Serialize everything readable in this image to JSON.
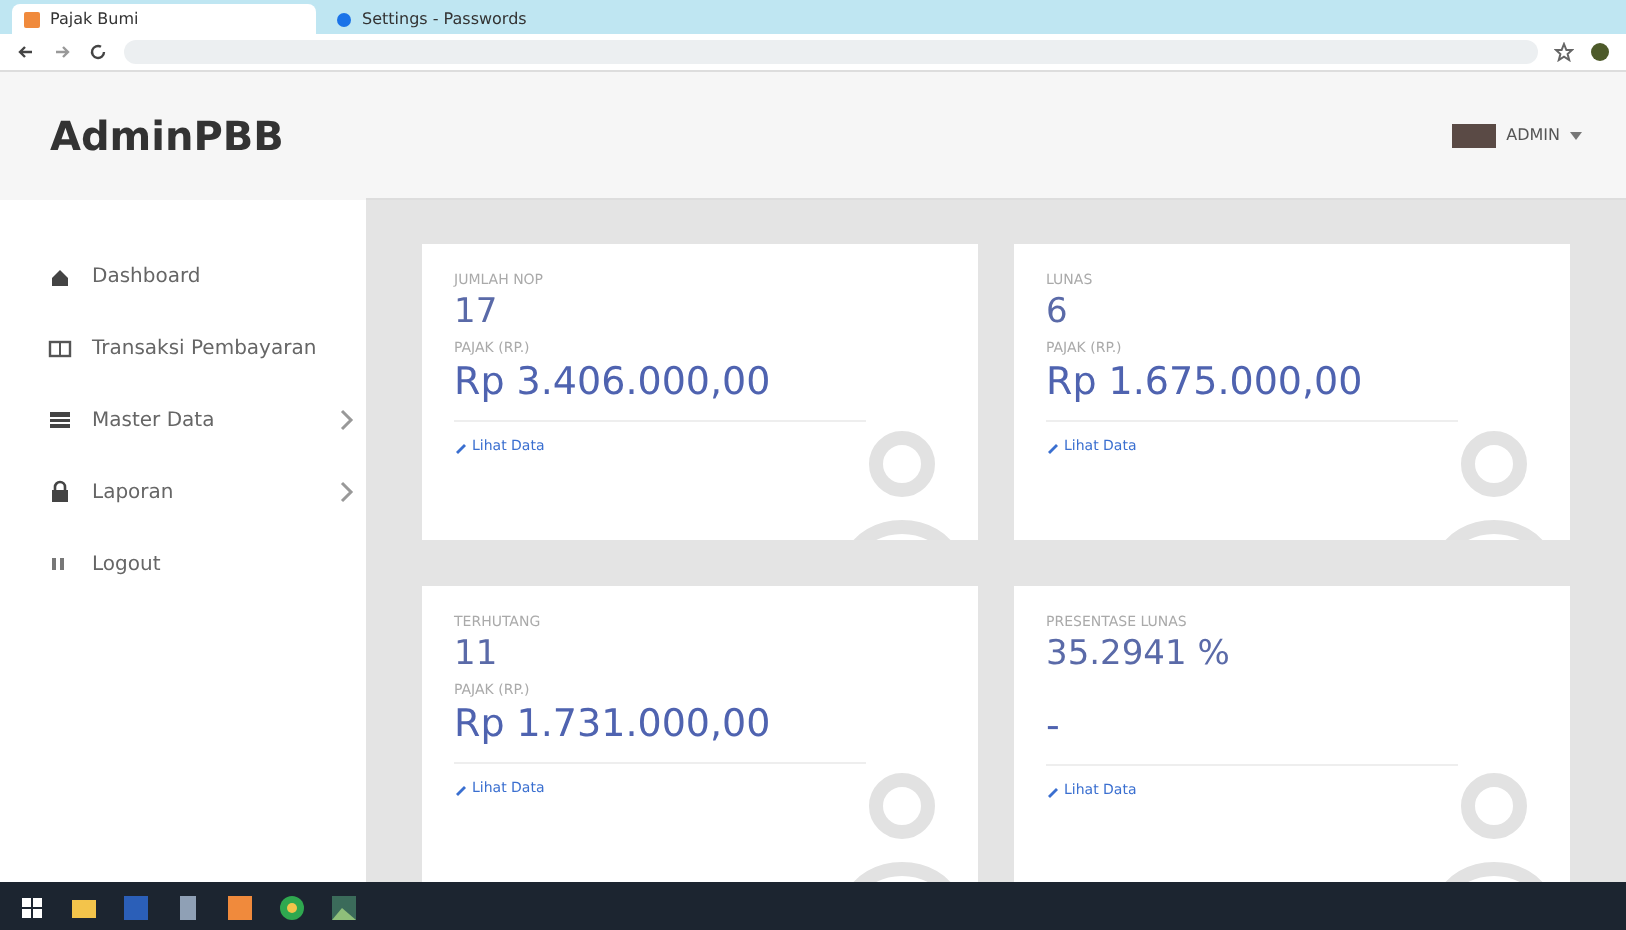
{
  "browser": {
    "tabs": [
      {
        "title": "Pajak Bumi",
        "selected": true
      },
      {
        "title": "Settings - Passwords",
        "selected": false
      }
    ]
  },
  "brand": "AdminPBB",
  "user": {
    "name": "ADMIN"
  },
  "sidebar": {
    "items": [
      {
        "label": "Dashboard",
        "expandable": false
      },
      {
        "label": "Transaksi Pembayaran",
        "expandable": false
      },
      {
        "label": "Master Data",
        "expandable": true
      },
      {
        "label": "Laporan",
        "expandable": true
      },
      {
        "label": "Logout",
        "expandable": false
      }
    ]
  },
  "cards": [
    {
      "label": "JUMLAH NOP",
      "value": "17",
      "sublabel": "PAJAK (RP.)",
      "amount": "Rp 3.406.000,00",
      "link": "Lihat Data"
    },
    {
      "label": "LUNAS",
      "value": "6",
      "sublabel": "PAJAK (RP.)",
      "amount": "Rp 1.675.000,00",
      "link": "Lihat Data"
    },
    {
      "label": "TERHUTANG",
      "value": "11",
      "sublabel": "PAJAK (RP.)",
      "amount": "Rp 1.731.000,00",
      "link": "Lihat Data"
    },
    {
      "label": "PRESENTASE LUNAS",
      "value": "35.2941 %",
      "amount": "-",
      "link": "Lihat Data"
    }
  ]
}
